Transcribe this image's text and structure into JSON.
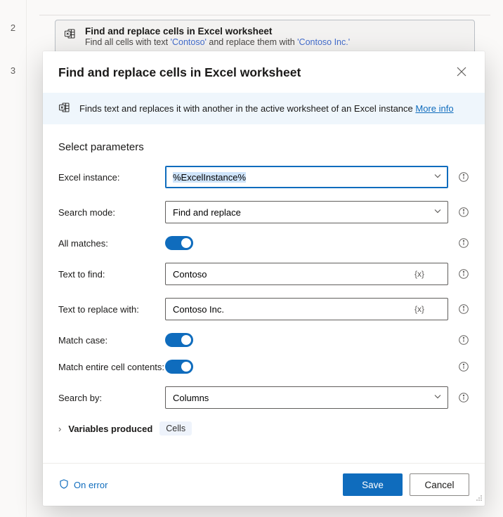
{
  "gutter": {
    "n2": "2",
    "n3": "3"
  },
  "card": {
    "title": "Find and replace cells in Excel worksheet",
    "sub_prefix": "Find all cells with text ",
    "sub_tok1": "'Contoso'",
    "sub_mid": " and replace them with ",
    "sub_tok2": "'Contoso Inc.'"
  },
  "dialog": {
    "title": "Find and replace cells in Excel worksheet",
    "info_text": "Finds text and replaces it with another in the active worksheet of an Excel instance ",
    "more_info": "More info",
    "section": "Select parameters",
    "labels": {
      "excel_instance": "Excel instance:",
      "search_mode": "Search mode:",
      "all_matches": "All matches:",
      "text_to_find": "Text to find:",
      "text_to_replace": "Text to replace with:",
      "match_case": "Match case:",
      "match_entire": "Match entire cell contents:",
      "search_by": "Search by:"
    },
    "values": {
      "excel_instance": "%ExcelInstance%",
      "search_mode": "Find and replace",
      "text_to_find": "Contoso",
      "text_to_replace": "Contoso Inc.",
      "search_by": "Columns",
      "var_token": "{x}"
    },
    "vars_caret": "›",
    "vars_label": "Variables produced",
    "vars_chip": "Cells",
    "on_error": "On error",
    "save": "Save",
    "cancel": "Cancel"
  }
}
